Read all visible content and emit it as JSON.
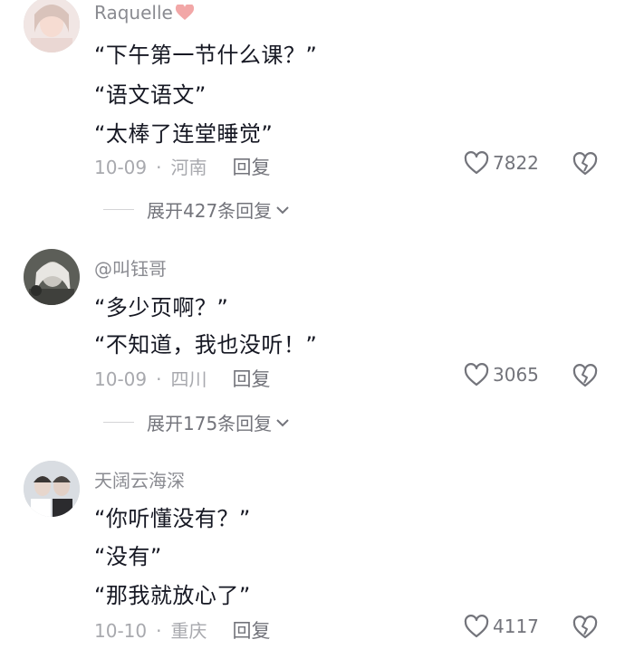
{
  "colors": {
    "text_primary": "#161823",
    "text_secondary": "#8a8b91",
    "text_muted": "#a8a9ae",
    "heart_badge": "#f2a7a7"
  },
  "comments": [
    {
      "username": "Raquelle",
      "badge_icon": "heart-badge-icon",
      "lines": [
        "“下午第一节什么课？”",
        "“语文语文”",
        "“太棒了连堂睡觉”"
      ],
      "date": "10-09",
      "separator": "·",
      "location": "河南",
      "reply_label": "回复",
      "like_count": "7822",
      "expand_label": "展开427条回复"
    },
    {
      "username": "@叫钰哥",
      "lines": [
        "“多少页啊？”",
        "“不知道，我也没听！”"
      ],
      "date": "10-09",
      "separator": "·",
      "location": "四川",
      "reply_label": "回复",
      "like_count": "3065",
      "expand_label": "展开175条回复"
    },
    {
      "username": "天阔云海深",
      "lines": [
        "“你听懂没有？”",
        "“没有”",
        "“那我就放心了”"
      ],
      "date": "10-10",
      "separator": "·",
      "location": "重庆",
      "reply_label": "回复",
      "like_count": "4117"
    }
  ]
}
